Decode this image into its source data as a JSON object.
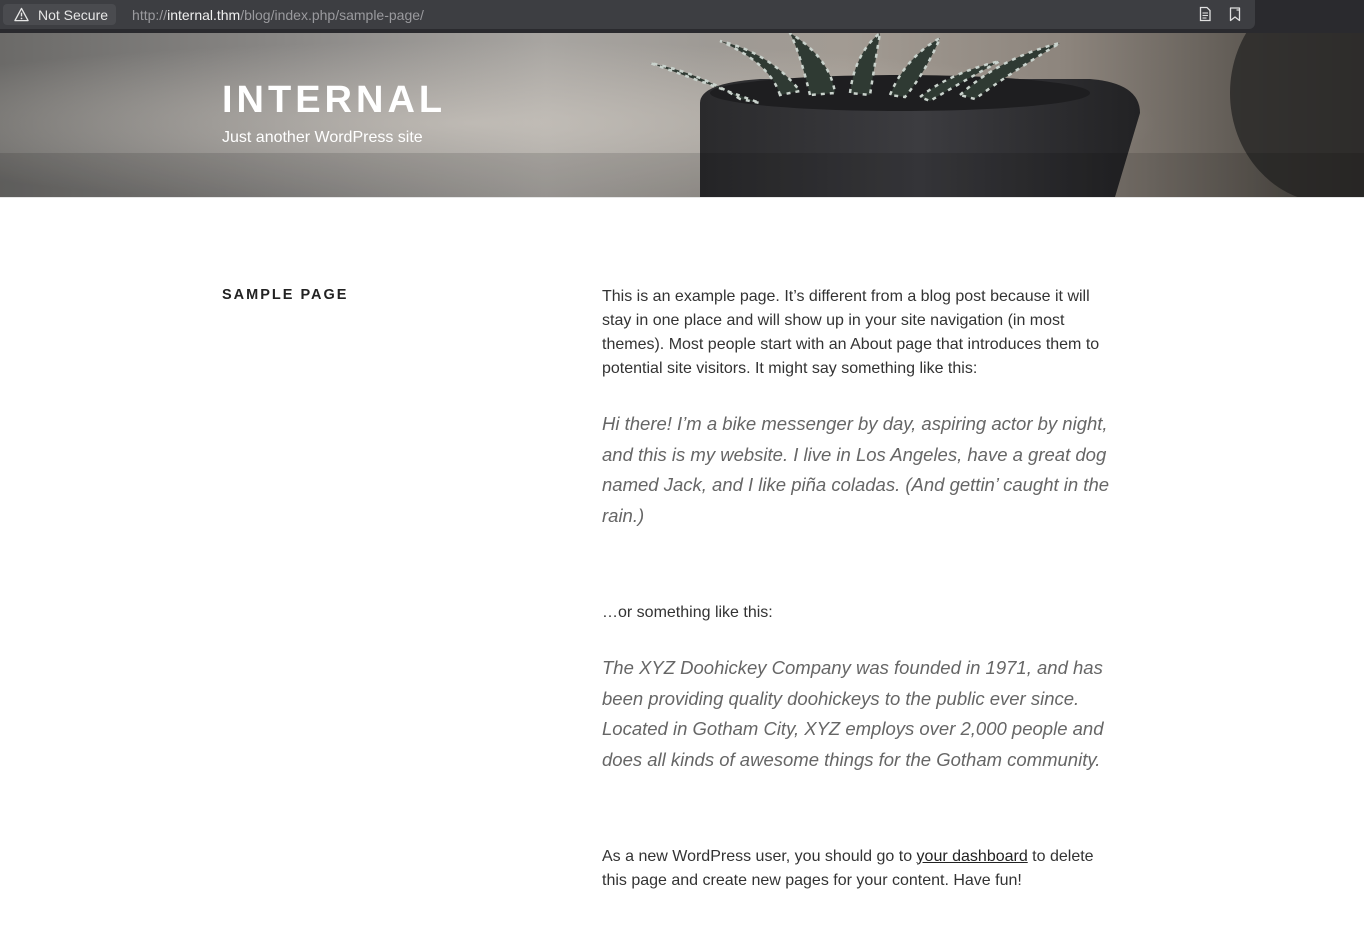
{
  "browser": {
    "security_label": "Not Secure",
    "url_scheme": "http://",
    "url_host": "internal.thm",
    "url_path": "/blog/index.php/sample-page/",
    "reader_icon": "reader-view-icon",
    "bookmark_icon": "bookmark-icon"
  },
  "header": {
    "site_title": "INTERNAL",
    "tagline": "Just another WordPress site"
  },
  "page": {
    "title": "SAMPLE PAGE",
    "intro": "This is an example page. It’s different from a blog post because it will stay in one place and will show up in your site navigation (in most themes). Most people start with an About page that introduces them to potential site visitors. It might say something like this:",
    "quote1": "Hi there! I’m a bike messenger by day, aspiring actor by night, and this is my website. I live in Los Angeles, have a great dog named Jack, and I like piña coladas. (And gettin’ caught in the rain.)",
    "middle": "…or something like this:",
    "quote2": "The XYZ Doohickey Company was founded in 1971, and has been providing quality doohickeys to the public ever since. Located in Gotham City, XYZ employs over 2,000 people and does all kinds of awesome things for the Gotham community.",
    "closing_before": "As a new WordPress user, you should go to ",
    "closing_link": "your dashboard",
    "closing_after": " to delete this page and create new pages for your content. Have fun!"
  },
  "colors": {
    "chrome_bg": "#2a2a2e",
    "url_bar_bg": "#3d3e42",
    "text": "#333333",
    "quote_text": "#666666"
  }
}
